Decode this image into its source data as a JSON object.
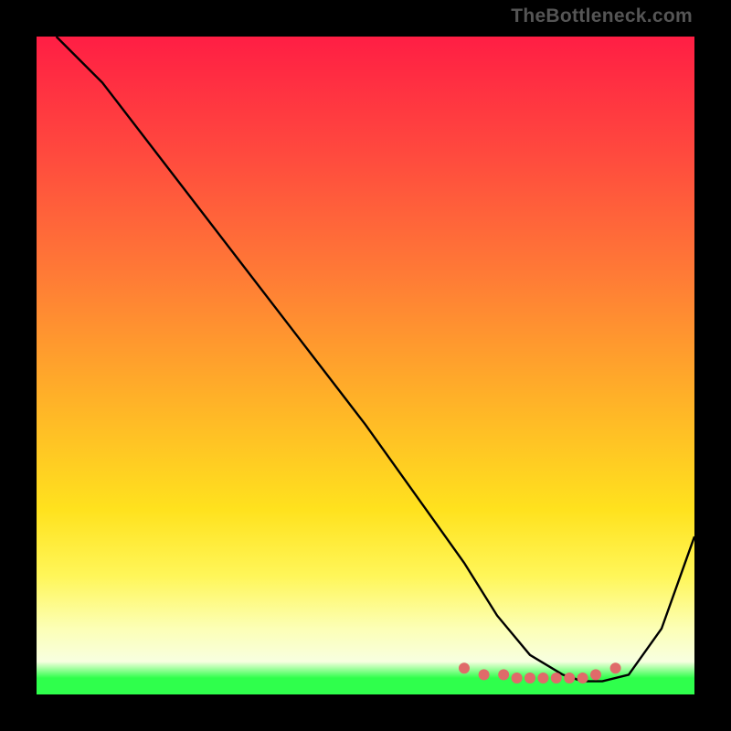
{
  "watermark": "TheBottleneck.com",
  "chart_data": {
    "type": "line",
    "title": "",
    "xlabel": "",
    "ylabel": "",
    "xlim": [
      0,
      100
    ],
    "ylim": [
      0,
      100
    ],
    "grid": false,
    "legend": false,
    "series": [
      {
        "name": "main-curve",
        "color": "#000000",
        "x": [
          3,
          6,
          10,
          20,
          30,
          40,
          50,
          60,
          65,
          70,
          75,
          80,
          83,
          86,
          90,
          95,
          100
        ],
        "y": [
          100,
          97,
          93,
          80,
          67,
          54,
          41,
          27,
          20,
          12,
          6,
          3,
          2,
          2,
          3,
          10,
          24
        ]
      },
      {
        "name": "bottom-markers",
        "color": "#e06a6a",
        "type": "scatter",
        "x": [
          65,
          68,
          71,
          73,
          75,
          77,
          79,
          81,
          83,
          85,
          88
        ],
        "y": [
          4,
          3,
          3,
          2.5,
          2.5,
          2.5,
          2.5,
          2.5,
          2.5,
          3,
          4
        ]
      }
    ],
    "gradient_stops": [
      {
        "pos": 0.0,
        "color": "#ff1e44"
      },
      {
        "pos": 0.18,
        "color": "#ff4a3e"
      },
      {
        "pos": 0.36,
        "color": "#ff7a36"
      },
      {
        "pos": 0.55,
        "color": "#ffb128"
      },
      {
        "pos": 0.72,
        "color": "#ffe21e"
      },
      {
        "pos": 0.82,
        "color": "#fff659"
      },
      {
        "pos": 0.9,
        "color": "#fcffb6"
      },
      {
        "pos": 0.95,
        "color": "#f8ffe0"
      },
      {
        "pos": 0.975,
        "color": "#2fff4c"
      },
      {
        "pos": 1.0,
        "color": "#2fff4c"
      }
    ]
  }
}
